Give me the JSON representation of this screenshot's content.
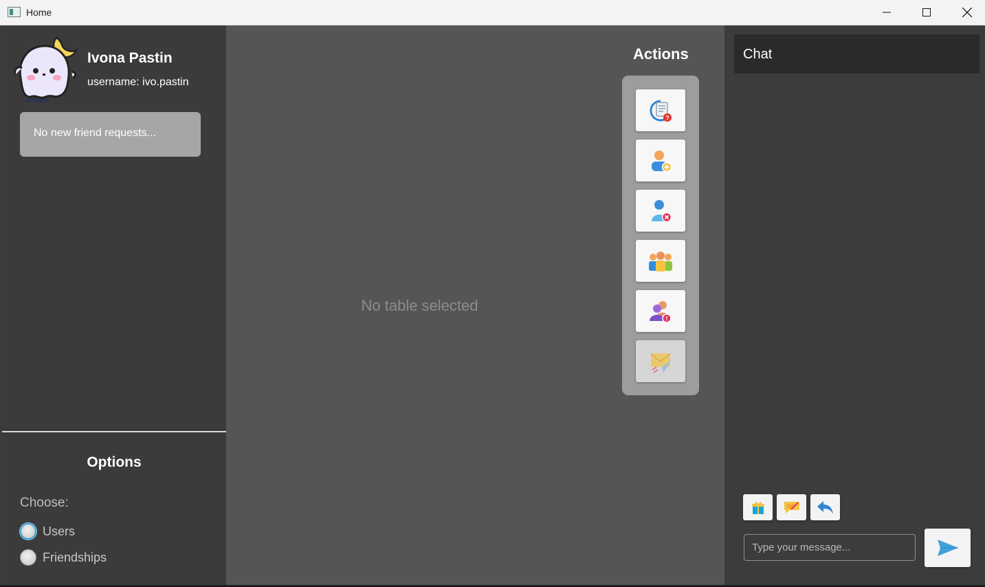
{
  "window": {
    "title": "Home",
    "controls": [
      "minimize-icon",
      "maximize-icon",
      "close-icon"
    ]
  },
  "profile": {
    "name": "Ivona Pastin",
    "username": "username: ivo.pastin",
    "avatar_icon": "ghost-avatar-icon"
  },
  "friend_requests": {
    "text": "No new friend requests..."
  },
  "options": {
    "title": "Options",
    "choose_label": "Choose:",
    "radios": [
      {
        "label": "Users",
        "selected": false,
        "focused": true
      },
      {
        "label": "Friendships",
        "selected": false,
        "focused": false
      }
    ]
  },
  "center": {
    "empty_text": "No table selected"
  },
  "actions": {
    "title": "Actions",
    "buttons": [
      {
        "icon": "search-report-icon",
        "enabled": true
      },
      {
        "icon": "add-user-icon",
        "enabled": true
      },
      {
        "icon": "remove-user-icon",
        "enabled": true
      },
      {
        "icon": "group-icon",
        "enabled": true
      },
      {
        "icon": "friend-alert-icon",
        "enabled": true
      },
      {
        "icon": "send-mail-icon",
        "enabled": false
      }
    ]
  },
  "chat": {
    "title": "Chat",
    "tool_buttons": [
      "gift-icon",
      "sticky-note-icon",
      "reply-icon"
    ],
    "input_placeholder": "Type your message...",
    "input_value": "",
    "send_icon": "send-icon"
  },
  "colors": {
    "left_panel": "#3b3b3b",
    "center_panel": "#545557",
    "right_panel": "#3c3c3c",
    "chat_header": "#2a2a2a",
    "actions_box": "#9d9d9d",
    "friend_request_box": "#a6a6a6",
    "accent_blue": "#3fa2d9"
  }
}
